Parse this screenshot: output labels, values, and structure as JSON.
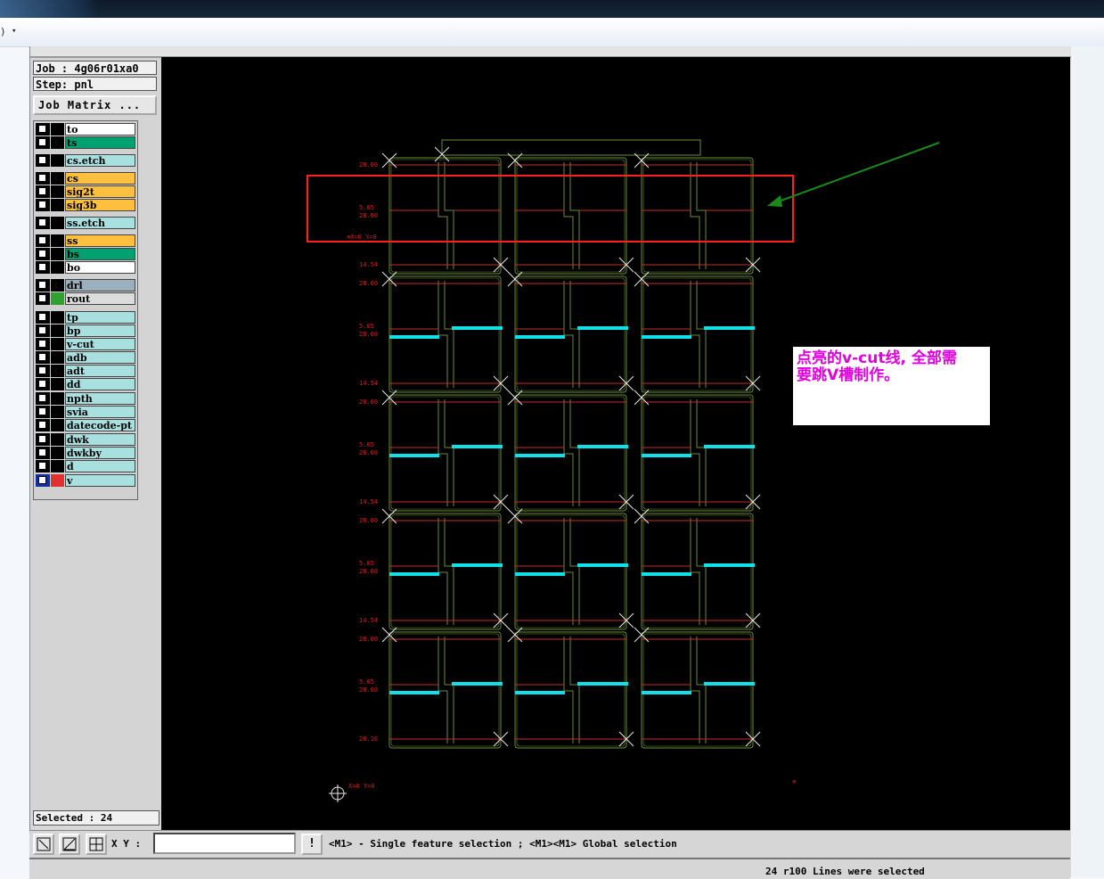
{
  "window": {
    "menu_fragment": ")",
    "menu_arrow": "▾"
  },
  "info": {
    "job": "Job : 4g06r01xa0",
    "step": "Step: pnl"
  },
  "job_matrix_label": "Job Matrix ...",
  "layers": [
    {
      "name": "to",
      "color": "#ffffff"
    },
    {
      "name": "ts",
      "color": "#00a070"
    },
    {
      "name": "cs.etch",
      "color": "#a8e0e0"
    },
    {
      "name": "cs",
      "color": "#ffc040"
    },
    {
      "name": "sig2t",
      "color": "#ffc040"
    },
    {
      "name": "sig3b",
      "color": "#ffc040"
    },
    {
      "name": "ss.etch",
      "color": "#a8e0e0"
    },
    {
      "name": "ss",
      "color": "#ffc040"
    },
    {
      "name": "bs",
      "color": "#00a070"
    },
    {
      "name": "bo",
      "color": "#ffffff"
    },
    {
      "name": "drl",
      "color": "#9ab0bc"
    },
    {
      "name": "rout",
      "color": "#dcdcdc"
    },
    {
      "name": "tp",
      "color": "#a8e0e0"
    },
    {
      "name": "bp",
      "color": "#a8e0e0"
    },
    {
      "name": "v-cut",
      "color": "#a8e0e0"
    },
    {
      "name": "adb",
      "color": "#a8e0e0"
    },
    {
      "name": "adt",
      "color": "#a8e0e0"
    },
    {
      "name": "dd",
      "color": "#a8e0e0"
    },
    {
      "name": "npth",
      "color": "#a8e0e0"
    },
    {
      "name": "svia",
      "color": "#a8e0e0"
    },
    {
      "name": "datecode-pt",
      "color": "#a8e0e0"
    },
    {
      "name": "dwk",
      "color": "#a8e0e0"
    },
    {
      "name": "dwkby",
      "color": "#a8e0e0"
    },
    {
      "name": "d",
      "color": "#a8e0e0"
    },
    {
      "name": "v",
      "color": "#a8e0e0"
    }
  ],
  "selected_text": "Selected : 24",
  "xy_label": "X Y :",
  "xy_value": "",
  "excl_label": "!",
  "hint": "<M1> - Single feature selection ; <M1><M1> Global selection",
  "status": "24 r100 Lines were selected",
  "annotation": {
    "line1": "点亮的v-cut线, 全部需",
    "line2": "要跳V槽制作。"
  },
  "dims": {
    "d1": "28.60",
    "d2": "5.65",
    "d3": "14.54",
    "d4": "28.16",
    "origin": "X=0 Y=0"
  },
  "colors": {
    "board": "#6a8c3a",
    "route": "#c0302a",
    "vcut": "#10e0e8",
    "highlight": "#ff2020",
    "arrow": "#1a8a1a"
  }
}
